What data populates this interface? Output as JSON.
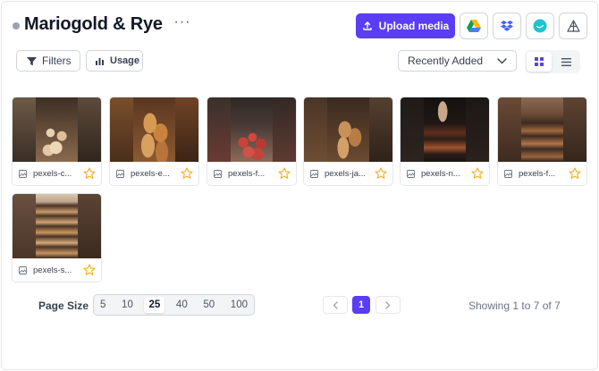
{
  "header": {
    "title": "Mariogold & Rye",
    "more_label": "···",
    "upload_label": "Upload media",
    "integrations": [
      "google-drive-icon",
      "dropbox-icon",
      "canva-icon",
      "shape-icon"
    ]
  },
  "toolbar": {
    "filters_label": "Filters",
    "usage_label": "Usage",
    "sort_value": "Recently Added",
    "view_modes": [
      "grid-view",
      "list-view"
    ],
    "active_view": "grid-view"
  },
  "media": [
    {
      "name": "pexels-c...",
      "starred": false
    },
    {
      "name": "pexels-e...",
      "starred": false
    },
    {
      "name": "pexels-f...",
      "starred": false
    },
    {
      "name": "pexels-ja...",
      "starred": false
    },
    {
      "name": "pexels-n...",
      "starred": false
    },
    {
      "name": "pexels-f...",
      "starred": false
    },
    {
      "name": "pexels-s...",
      "starred": false
    }
  ],
  "pagination": {
    "page_size_label": "Page Size",
    "page_sizes": [
      "5",
      "10",
      "25",
      "40",
      "50",
      "100"
    ],
    "selected_page_size": "25",
    "current_page": "1",
    "showing_text": "Showing 1 to 7 of 7"
  },
  "colors": {
    "accent": "#5b3df5",
    "star": "#f2b233",
    "border": "#d1d5db"
  }
}
